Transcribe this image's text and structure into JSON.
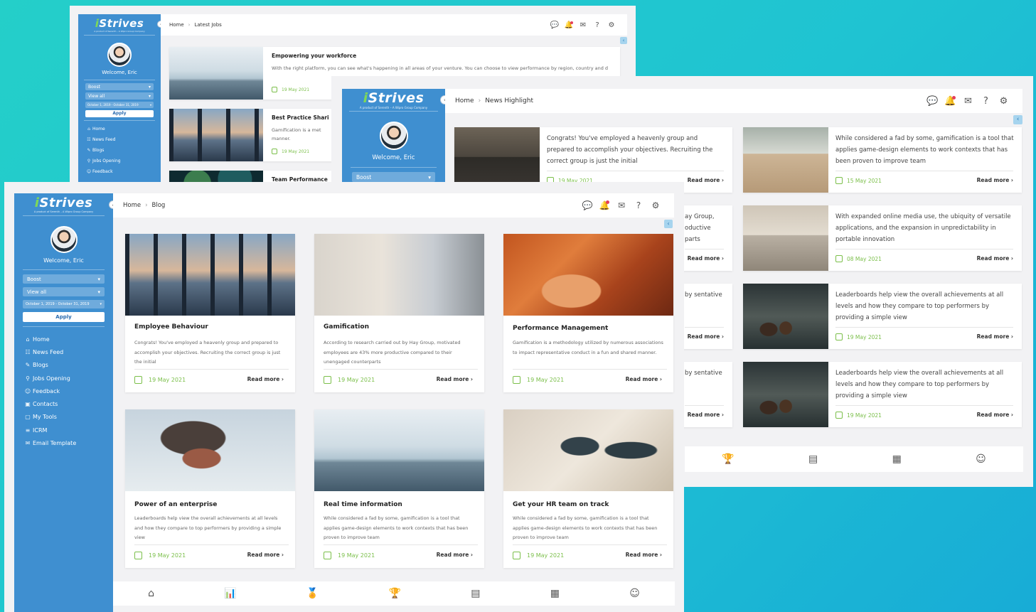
{
  "brand": {
    "name": "Strives",
    "tagline": "A product of Serenth – A Wipro Group Company"
  },
  "user": {
    "welcome": "Welcome, Eric"
  },
  "filters": {
    "boost": "Boost",
    "view_all": "View all",
    "date_range": "October 1, 2019 - October 31, 2019",
    "apply": "Apply"
  },
  "nav": [
    {
      "label": "Home",
      "icon": "home-icon"
    },
    {
      "label": "News Feed",
      "icon": "news-icon"
    },
    {
      "label": "Blogs",
      "icon": "blog-icon"
    },
    {
      "label": "Jobs Opening",
      "icon": "briefcase-icon"
    },
    {
      "label": "Feedback",
      "icon": "feedback-icon"
    },
    {
      "label": "Contacts",
      "icon": "contacts-icon"
    },
    {
      "label": "My Tools",
      "icon": "tools-icon"
    },
    {
      "label": "ICRM",
      "icon": "icrm-icon"
    },
    {
      "label": "Email Template",
      "icon": "email-template-icon"
    }
  ],
  "breadcrumb_home": "Home",
  "win1": {
    "crumb": "Latest Jobs",
    "items": [
      {
        "title": "Empowering your workforce",
        "text": "With the right platform, you can see what's happening in all areas of your venture. You can choose to view performance by region, country and d",
        "date": "19 May 2021"
      },
      {
        "title": "Best Practice Shari",
        "text": "Gamification is a met manner.",
        "date": "19 May 2021"
      },
      {
        "title": "Team Performance"
      }
    ]
  },
  "win2": {
    "crumb": "News Highlight",
    "left": [
      {
        "text": "Congrats! You've employed a heavenly group and prepared to accomplish your objectives. Recruiting the correct group is just the initial",
        "date": "19 May 2021",
        "more": "Read more"
      },
      {
        "text": "ay Group, oductive parts",
        "more": "Read more"
      },
      {
        "text": "by sentative",
        "more": "Read more"
      },
      {
        "text": "by sentative",
        "more": "Read more"
      }
    ],
    "right": [
      {
        "text": "While considered a fad by some, gamification is a tool that applies game-design elements to work contexts that has been proven to improve team",
        "date": "15 May 2021",
        "more": "Read more"
      },
      {
        "text": "With expanded online media use, the ubiquity of versatile applications, and the expansion in unpredictability in portable innovation",
        "date": "08 May 2021",
        "more": "Read more"
      },
      {
        "text": "Leaderboards help view the overall achievements at all levels and how they compare to top performers by providing a simple view",
        "date": "19 May 2021",
        "more": "Read more"
      },
      {
        "text": "Leaderboards help view the overall achievements at all levels and how they compare to top performers by providing a simple view",
        "date": "19 May 2021",
        "more": "Read more"
      }
    ]
  },
  "win3": {
    "crumb": "Blog",
    "cards": [
      {
        "title": "Employee Behaviour",
        "text": "Congrats! You've employed a heavenly group and prepared to accomplish your objectives. Recruiting the correct group is just the initial",
        "date": "19 May 2021",
        "more": "Read more"
      },
      {
        "title": "Gamification",
        "text": "According to research carried out by Hay Group, motivated employees are 43% more productive compared to their unengaged counterparts",
        "date": "19 May 2021",
        "more": "Read more"
      },
      {
        "title": "Performance Management",
        "text": "Gamification is a methodology utilized by numerous associations to impact representative conduct in a fun and shared manner.",
        "date": "19 May 2021",
        "more": "Read more"
      },
      {
        "title": "Power of an enterprise",
        "text": "Leaderboards help view the overall achievements at all levels and how they compare to top performers by providing a simple view",
        "date": "19 May 2021",
        "more": "Read more"
      },
      {
        "title": "Real time information",
        "text": "While considered a fad by some, gamification is a tool that applies game-design elements to work contexts that has been proven to improve team",
        "date": "19 May 2021",
        "more": "Read more"
      },
      {
        "title": "Get your HR team on track",
        "text": "While considered a fad by some, gamification is a tool that applies game-design elements to work contexts that has been proven to improve team",
        "date": "19 May 2021",
        "more": "Read more"
      }
    ]
  },
  "icons": {
    "top": [
      "chat-icon",
      "bell-icon",
      "mail-icon",
      "help-icon",
      "settings-icon"
    ],
    "bottom": [
      "home-icon",
      "chart-icon",
      "badge-icon",
      "trophy-icon",
      "report-icon",
      "calendar-icon",
      "smiley-icon"
    ]
  },
  "colors": {
    "sidebar": "#3f8fd0",
    "accent_green": "#7bbf4a",
    "notification": "#e53e5b"
  }
}
